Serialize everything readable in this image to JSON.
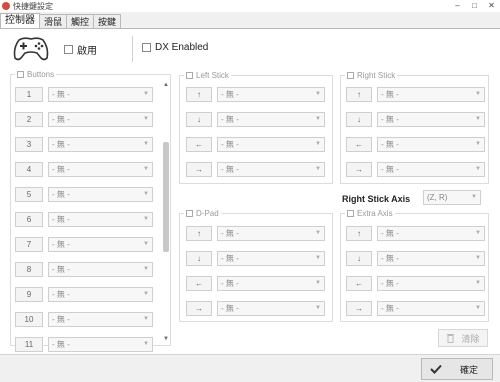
{
  "window": {
    "title": "快捷鍵設定",
    "minimize": "–",
    "maximize": "□",
    "close": "✕"
  },
  "tabs": [
    {
      "label": "控制器"
    },
    {
      "label": "滑鼠"
    },
    {
      "label": "觸控"
    },
    {
      "label": "按鍵"
    }
  ],
  "header": {
    "enable_label": "啟用",
    "dx_label": "DX Enabled"
  },
  "unassigned": "- 無 -",
  "buttons_group": {
    "title": "Buttons",
    "items": [
      {
        "label": "1",
        "value": "- 無 -"
      },
      {
        "label": "2",
        "value": "- 無 -"
      },
      {
        "label": "3",
        "value": "- 無 -"
      },
      {
        "label": "4",
        "value": "- 無 -"
      },
      {
        "label": "5",
        "value": "- 無 -"
      },
      {
        "label": "6",
        "value": "- 無 -"
      },
      {
        "label": "7",
        "value": "- 無 -"
      },
      {
        "label": "8",
        "value": "- 無 -"
      },
      {
        "label": "9",
        "value": "- 無 -"
      },
      {
        "label": "10",
        "value": "- 無 -"
      },
      {
        "label": "11",
        "value": "- 無 -"
      }
    ]
  },
  "left_stick": {
    "title": "Left Stick",
    "items": [
      {
        "label": "↑",
        "value": "- 無 -"
      },
      {
        "label": "↓",
        "value": "- 無 -"
      },
      {
        "label": "←",
        "value": "- 無 -"
      },
      {
        "label": "→",
        "value": "- 無 -"
      }
    ]
  },
  "right_stick": {
    "title": "Right Stick",
    "items": [
      {
        "label": "↑",
        "value": "- 無 -"
      },
      {
        "label": "↓",
        "value": "- 無 -"
      },
      {
        "label": "←",
        "value": "- 無 -"
      },
      {
        "label": "→",
        "value": "- 無 -"
      }
    ]
  },
  "right_stick_axis": {
    "label": "Right Stick Axis",
    "value": "(Z, R)"
  },
  "dpad": {
    "title": "D-Pad",
    "items": [
      {
        "label": "↑",
        "value": "- 無 -"
      },
      {
        "label": "↓",
        "value": "- 無 -"
      },
      {
        "label": "←",
        "value": "- 無 -"
      },
      {
        "label": "→",
        "value": "- 無 -"
      }
    ]
  },
  "extra_axis": {
    "title": "Extra Axis",
    "items": [
      {
        "label": "↑",
        "value": "- 無 -"
      },
      {
        "label": "↓",
        "value": "- 無 -"
      },
      {
        "label": "←",
        "value": "- 無 -"
      },
      {
        "label": "→",
        "value": "- 無 -"
      }
    ]
  },
  "clear_label": "清除",
  "ok_label": "確定",
  "icons": {
    "app": "app-icon",
    "controller": "gamepad-icon",
    "trash": "trash-icon",
    "check": "check-icon"
  }
}
